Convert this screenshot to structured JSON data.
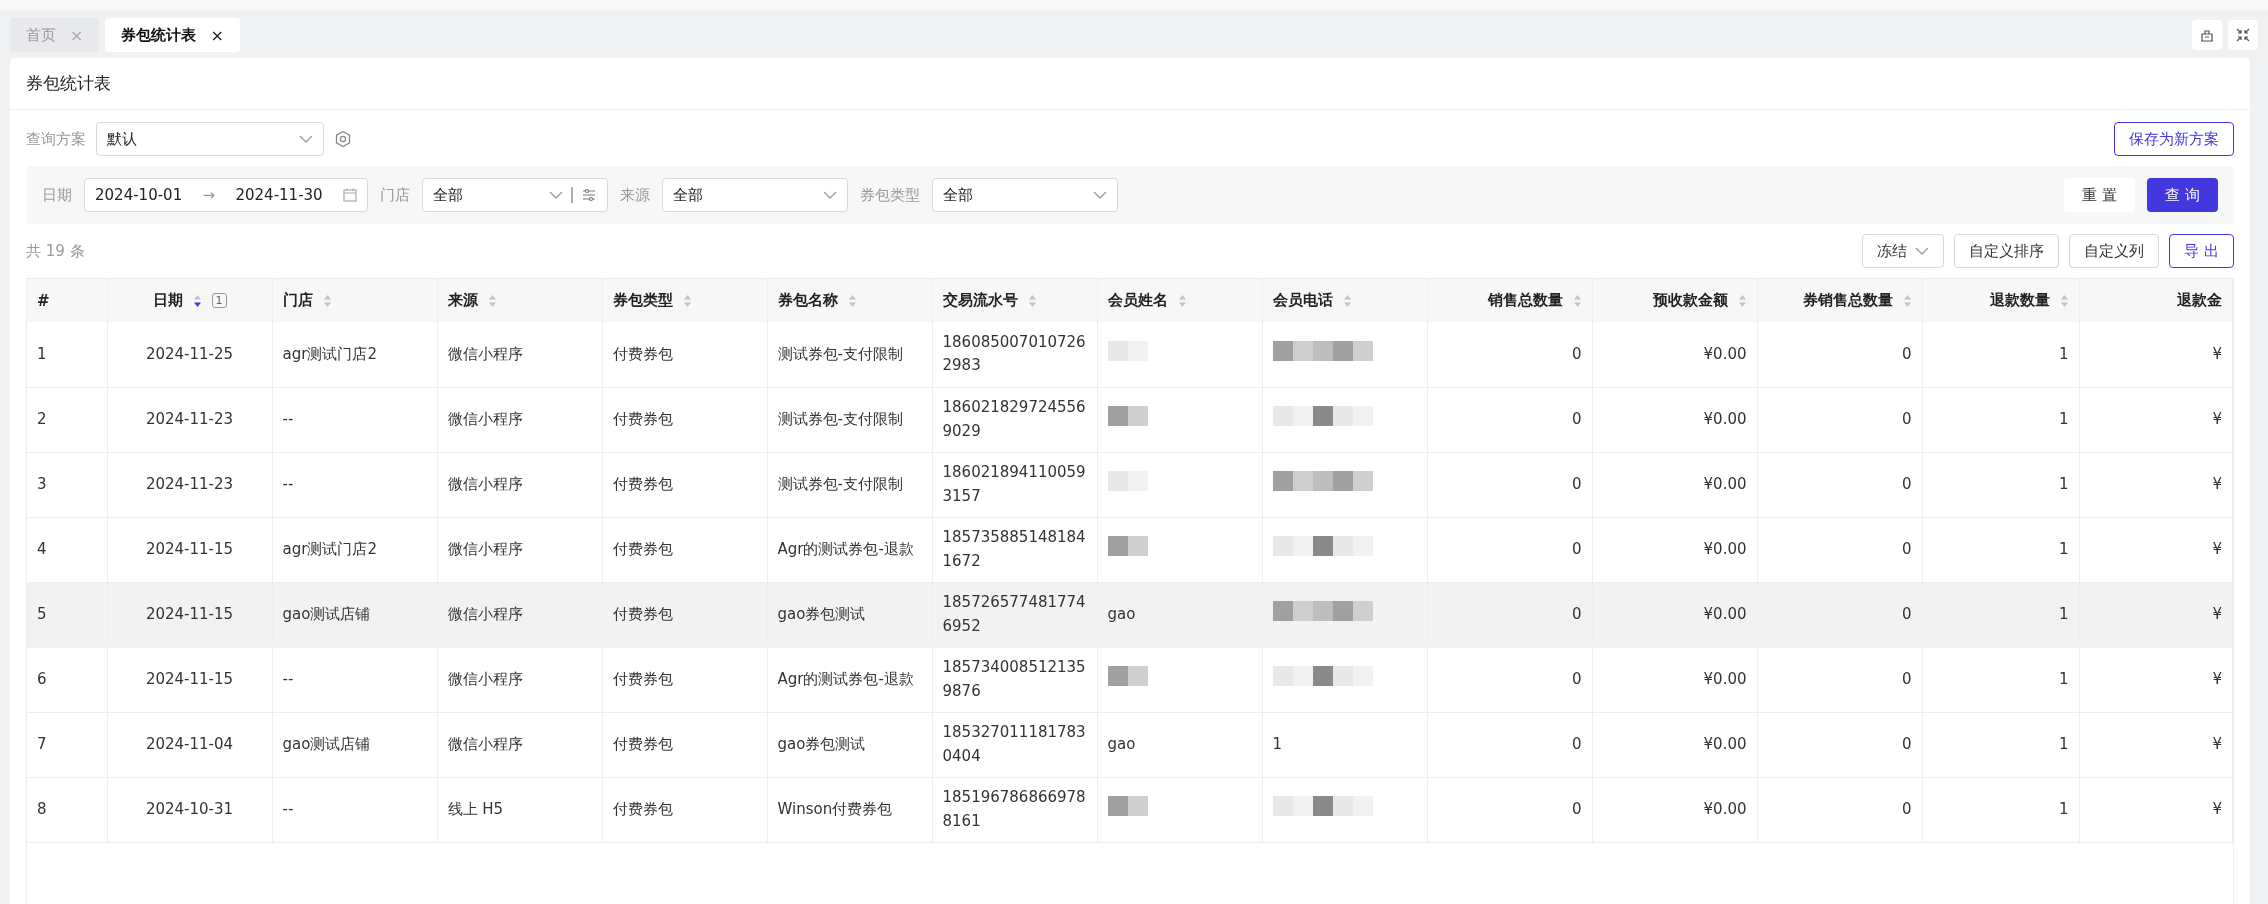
{
  "tabs": [
    {
      "label": "首页",
      "selected": false,
      "close": "×"
    },
    {
      "label": "券包统计表",
      "selected": true,
      "close": "×"
    }
  ],
  "page_title": "券包统计表",
  "query_scheme": {
    "label": "查询方案",
    "value": "默认"
  },
  "save_button": "保存为新方案",
  "filters": [
    {
      "kind": "daterange",
      "label": "日期",
      "start": "2024-10-01",
      "arrow": "→",
      "end": "2024-11-30"
    },
    {
      "kind": "select",
      "label": "门店",
      "value": "全部",
      "extra": true
    },
    {
      "kind": "select",
      "label": "来源",
      "value": "全部"
    },
    {
      "kind": "select",
      "label": "券包类型",
      "value": "全部"
    }
  ],
  "filter_buttons": [
    {
      "label": "重 置",
      "kind": "plain"
    },
    {
      "label": "查 询",
      "kind": "primary"
    }
  ],
  "total": "共 19 条",
  "table_buttons": [
    {
      "label": "冻结",
      "kind": "dropdown"
    },
    {
      "label": "自定义排序",
      "kind": "default"
    },
    {
      "label": "自定义列",
      "kind": "default"
    },
    {
      "label": "导 出",
      "kind": "outline"
    }
  ],
  "table": {
    "columns": [
      {
        "label": "#"
      },
      {
        "label": "日期",
        "sorted": true,
        "rank": "1"
      },
      {
        "label": "门店",
        "sorted": false
      },
      {
        "label": "来源",
        "sorted": false
      },
      {
        "label": "券包类型",
        "sorted": false
      },
      {
        "label": "券包名称",
        "sorted": false
      },
      {
        "label": "交易流水号",
        "sorted": false
      },
      {
        "label": "会员姓名",
        "sorted": false
      },
      {
        "label": "会员电话",
        "sorted": false
      },
      {
        "label": "销售总数量",
        "sorted": false
      },
      {
        "label": "预收款金额",
        "sorted": false
      },
      {
        "label": "券销售总数量",
        "sorted": false
      },
      {
        "label": "退款数量",
        "sorted": false
      },
      {
        "label": "退款金"
      }
    ],
    "rows": [
      {
        "selected": false,
        "cells": [
          {
            "text": "1"
          },
          {
            "text": "2024-11-25"
          },
          {
            "text": "agr测试门店2"
          },
          {
            "text": "微信小程序"
          },
          {
            "text": "付费券包"
          },
          {
            "text": "测试券包-支付限制"
          },
          {
            "text": "1860850070107262983"
          },
          {
            "redacted": true
          },
          {
            "redacted": true
          },
          {
            "text": "0"
          },
          {
            "text": "¥0.00"
          },
          {
            "text": "0"
          },
          {
            "text": "1"
          },
          {
            "text": "¥"
          }
        ]
      },
      {
        "selected": false,
        "cells": [
          {
            "text": "2"
          },
          {
            "text": "2024-11-23"
          },
          {
            "text": "--"
          },
          {
            "text": "微信小程序"
          },
          {
            "text": "付费券包"
          },
          {
            "text": "测试券包-支付限制"
          },
          {
            "text": "1860218297245569029"
          },
          {
            "redacted": true
          },
          {
            "redacted": true
          },
          {
            "text": "0"
          },
          {
            "text": "¥0.00"
          },
          {
            "text": "0"
          },
          {
            "text": "1"
          },
          {
            "text": "¥"
          }
        ]
      },
      {
        "selected": false,
        "cells": [
          {
            "text": "3"
          },
          {
            "text": "2024-11-23"
          },
          {
            "text": "--"
          },
          {
            "text": "微信小程序"
          },
          {
            "text": "付费券包"
          },
          {
            "text": "测试券包-支付限制"
          },
          {
            "text": "1860218941100593157"
          },
          {
            "redacted": true
          },
          {
            "redacted": true
          },
          {
            "text": "0"
          },
          {
            "text": "¥0.00"
          },
          {
            "text": "0"
          },
          {
            "text": "1"
          },
          {
            "text": "¥"
          }
        ]
      },
      {
        "selected": false,
        "cells": [
          {
            "text": "4"
          },
          {
            "text": "2024-11-15"
          },
          {
            "text": "agr测试门店2"
          },
          {
            "text": "微信小程序"
          },
          {
            "text": "付费券包"
          },
          {
            "text": "Agr的测试券包-退款"
          },
          {
            "text": "1857358851481841672"
          },
          {
            "redacted": true
          },
          {
            "redacted": true
          },
          {
            "text": "0"
          },
          {
            "text": "¥0.00"
          },
          {
            "text": "0"
          },
          {
            "text": "1"
          },
          {
            "text": "¥"
          }
        ]
      },
      {
        "selected": true,
        "cells": [
          {
            "text": "5"
          },
          {
            "text": "2024-11-15"
          },
          {
            "text": "gao测试店铺"
          },
          {
            "text": "微信小程序"
          },
          {
            "text": "付费券包"
          },
          {
            "text": "gao券包测试"
          },
          {
            "text": "1857265774817746952"
          },
          {
            "text": "gao"
          },
          {
            "redacted": true
          },
          {
            "text": "0"
          },
          {
            "text": "¥0.00"
          },
          {
            "text": "0"
          },
          {
            "text": "1"
          },
          {
            "text": "¥"
          }
        ]
      },
      {
        "selected": false,
        "cells": [
          {
            "text": "6"
          },
          {
            "text": "2024-11-15"
          },
          {
            "text": "--"
          },
          {
            "text": "微信小程序"
          },
          {
            "text": "付费券包"
          },
          {
            "text": "Agr的测试券包-退款"
          },
          {
            "text": "1857340085121359876"
          },
          {
            "redacted": true
          },
          {
            "redacted": true
          },
          {
            "text": "0"
          },
          {
            "text": "¥0.00"
          },
          {
            "text": "0"
          },
          {
            "text": "1"
          },
          {
            "text": "¥"
          }
        ]
      },
      {
        "selected": false,
        "cells": [
          {
            "text": "7"
          },
          {
            "text": "2024-11-04"
          },
          {
            "text": "gao测试店铺"
          },
          {
            "text": "微信小程序"
          },
          {
            "text": "付费券包"
          },
          {
            "text": "gao券包测试"
          },
          {
            "text": "1853270111817830404"
          },
          {
            "text": "gao"
          },
          {
            "text": "1"
          },
          {
            "text": "0"
          },
          {
            "text": "¥0.00"
          },
          {
            "text": "0"
          },
          {
            "text": "1"
          },
          {
            "text": "¥"
          }
        ]
      },
      {
        "selected": false,
        "cells": [
          {
            "text": "8"
          },
          {
            "text": "2024-10-31"
          },
          {
            "text": "--"
          },
          {
            "text": "线上 H5"
          },
          {
            "text": "付费券包"
          },
          {
            "text": "Winson付费券包"
          },
          {
            "text": "1851967868669788161"
          },
          {
            "redacted": true
          },
          {
            "redacted": true
          },
          {
            "text": "0"
          },
          {
            "text": "¥0.00"
          },
          {
            "text": "0"
          },
          {
            "text": "1"
          },
          {
            "text": "¥"
          }
        ]
      }
    ]
  }
}
